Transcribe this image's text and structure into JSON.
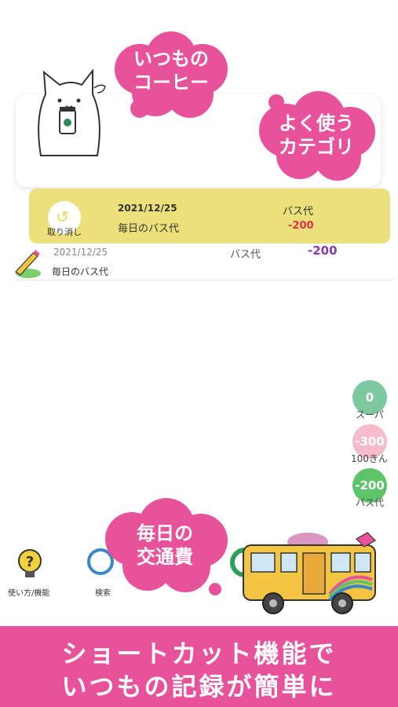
{
  "callouts": {
    "coffee": [
      "いつもの",
      "コーヒー"
    ],
    "category": [
      "よく使う",
      "カテゴリ"
    ],
    "transport": [
      "毎日の",
      "交通費"
    ]
  },
  "swipe_entry": {
    "undo_label": "取り消し",
    "date": "2021/12/25",
    "memo": "毎日のバス代",
    "category": "バス代",
    "amount": "-200"
  },
  "list_entry": {
    "date": "2021/12/25",
    "memo": "毎日のバス代",
    "category": "バス代",
    "amount": "-200"
  },
  "shortcuts": [
    {
      "value": "0",
      "label": "スーパ",
      "color": "#7cc9a0"
    },
    {
      "value": "-300",
      "label": "100きん",
      "color": "#f6bccb"
    },
    {
      "value": "-200",
      "label": "バス代",
      "color": "#5ec46a"
    }
  ],
  "nav": [
    {
      "label": "使い方/機能",
      "icon": "lightbulb-question-icon"
    },
    {
      "label": "検索",
      "icon": "search-icon"
    },
    {
      "label": "",
      "icon": "pie-chart-icon"
    }
  ],
  "banner": {
    "line1": "ショートカット機能で",
    "line2": "いつもの記録が簡単に"
  },
  "colors": {
    "accent_pink": "#e8529a",
    "swipe_yellow": "#ece07a",
    "amount_red": "#e0314b",
    "amount_purple": "#8a3aa8"
  }
}
